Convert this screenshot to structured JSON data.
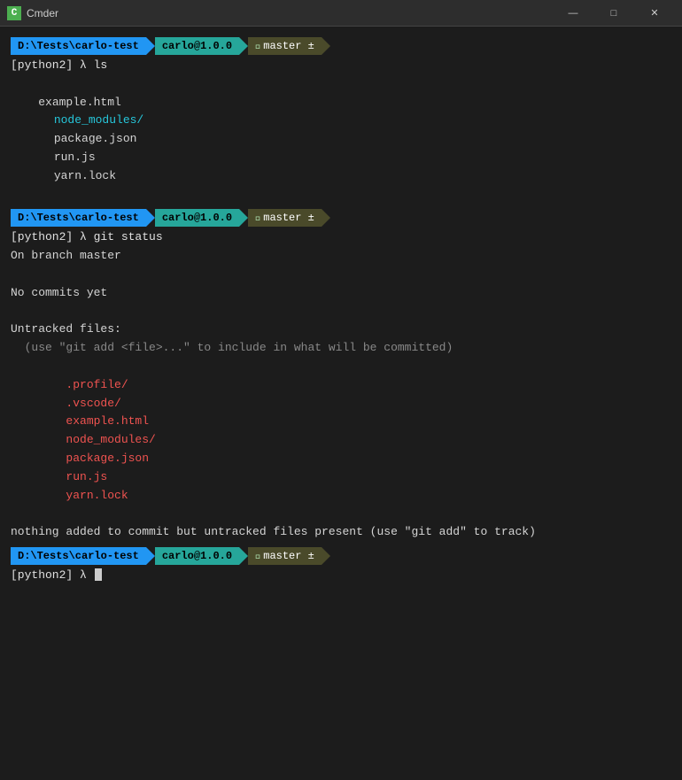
{
  "window": {
    "title": "Cmder",
    "icon_label": "C",
    "controls": {
      "minimize": "—",
      "maximize": "□",
      "close": "✕"
    }
  },
  "terminal": {
    "prompt1": {
      "path": "D:\\Tests\\carlo-test",
      "user": "carlo@1.0.0",
      "branch": "master ±"
    },
    "cmd1": "[python2] λ ls",
    "ls_output": "example.html  node_modules/  package.json  run.js  yarn.lock",
    "prompt2": {
      "path": "D:\\Tests\\carlo-test",
      "user": "carlo@1.0.0",
      "branch": "master ±"
    },
    "cmd2": "[python2] λ git status",
    "git_status": {
      "line1": "On branch master",
      "line2": "",
      "line3": "No commits yet",
      "line4": "",
      "line5": "Untracked files:",
      "line6": "  (use \"git add <file>...\" to include in what will be committed)",
      "line7": "",
      "files": [
        ".profile/",
        ".vscode/",
        "example.html",
        "node_modules/",
        "package.json",
        "run.js",
        "yarn.lock"
      ],
      "line_end": "",
      "summary": "nothing added to commit but untracked files present (use \"git add\" to track)"
    },
    "prompt3": {
      "path": "D:\\Tests\\carlo-test",
      "user": "carlo@1.0.0",
      "branch": "master ±"
    },
    "cmd3": "[python2] λ "
  }
}
